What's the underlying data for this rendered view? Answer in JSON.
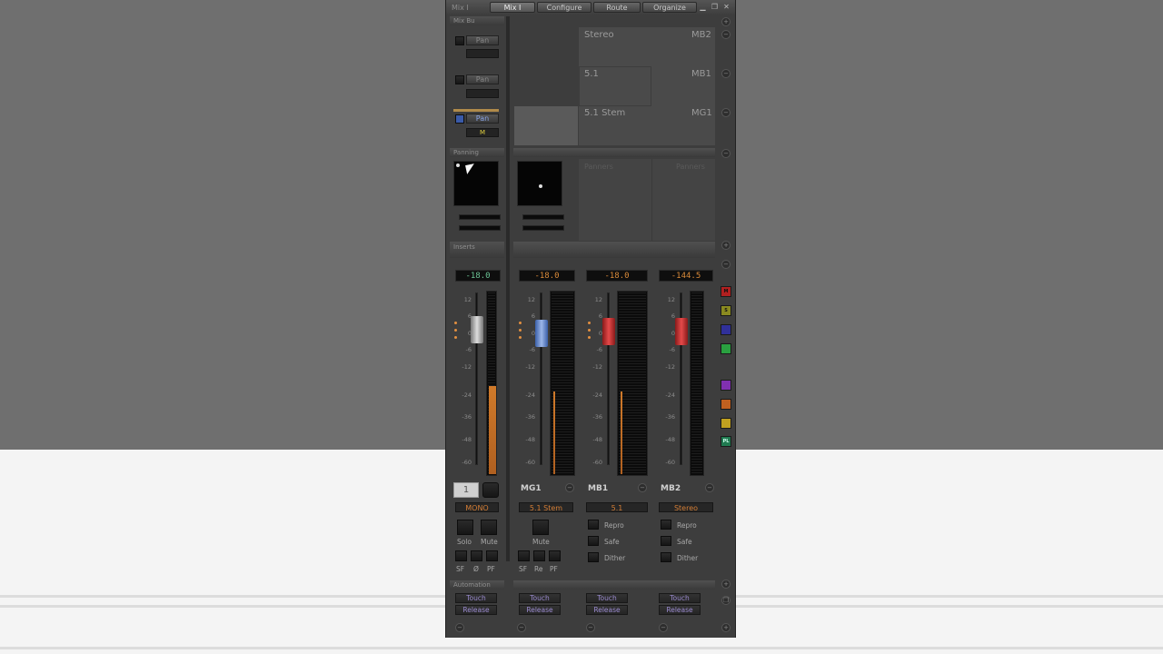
{
  "window": {
    "title": "Mix I",
    "tabs": [
      {
        "label": "Mix I",
        "active": true
      },
      {
        "label": "Configure",
        "active": false
      },
      {
        "label": "Route",
        "active": false
      },
      {
        "label": "Organize",
        "active": false
      }
    ],
    "controls": [
      "minimize-icon",
      "restore-icon",
      "close-icon"
    ]
  },
  "sections": {
    "mix_bus": "Mix Bu",
    "panning": "Panning",
    "inserts": "Inserts",
    "automation": "Automation"
  },
  "routing": {
    "pan_label": "Pan",
    "rows": [
      {
        "name": "Stereo",
        "bus": "MB2"
      },
      {
        "name": "5.1",
        "bus": "MB1"
      },
      {
        "name": "5.1 Stem",
        "bus": "MG1"
      }
    ],
    "panners_ghost": [
      "Panners",
      "Panners"
    ]
  },
  "strips": [
    {
      "level": "-18.0",
      "name": "1",
      "format": "MONO",
      "buttons": [
        "Solo",
        "Mute"
      ],
      "small": [
        "SF",
        "Ø",
        "PF"
      ]
    },
    {
      "level": "-18.0",
      "name": "MG1",
      "format": "5.1 Stem",
      "buttons": [
        "Mute"
      ],
      "small": [
        "SF",
        "Re",
        "PF"
      ]
    },
    {
      "level": "-18.0",
      "name": "MB1",
      "format": "5.1",
      "options": [
        "Repro",
        "Safe",
        "Dither"
      ]
    },
    {
      "level": "-144.5",
      "name": "MB2",
      "format": "Stereo",
      "options": [
        "Repro",
        "Safe",
        "Dither"
      ]
    }
  ],
  "scale": [
    "12",
    "6",
    "0",
    "-6",
    "-12",
    "-24",
    "-36",
    "-48",
    "-60"
  ],
  "meter_levels": [
    0.48,
    0.45,
    0.45,
    0
  ],
  "automation": {
    "touch": "Touch",
    "release": "Release"
  },
  "plugins": [
    {
      "icon": "plugin-m-icon",
      "color": "#b02020",
      "label": "M"
    },
    {
      "icon": "plugin-s-icon",
      "color": "#8a8a20",
      "label": "S"
    },
    {
      "icon": "plugin-blue-icon",
      "color": "#30309a",
      "label": ""
    },
    {
      "icon": "plugin-green-icon",
      "color": "#2aa040",
      "label": ""
    },
    {
      "icon": "plugin-purple-icon",
      "color": "#8030b0",
      "label": ""
    },
    {
      "icon": "plugin-orange-icon",
      "color": "#c06020",
      "label": ""
    },
    {
      "icon": "plugin-yellow-icon",
      "color": "#c0a020",
      "label": ""
    },
    {
      "icon": "plugin-pl-icon",
      "color": "#207a50",
      "label": "PL"
    }
  ]
}
